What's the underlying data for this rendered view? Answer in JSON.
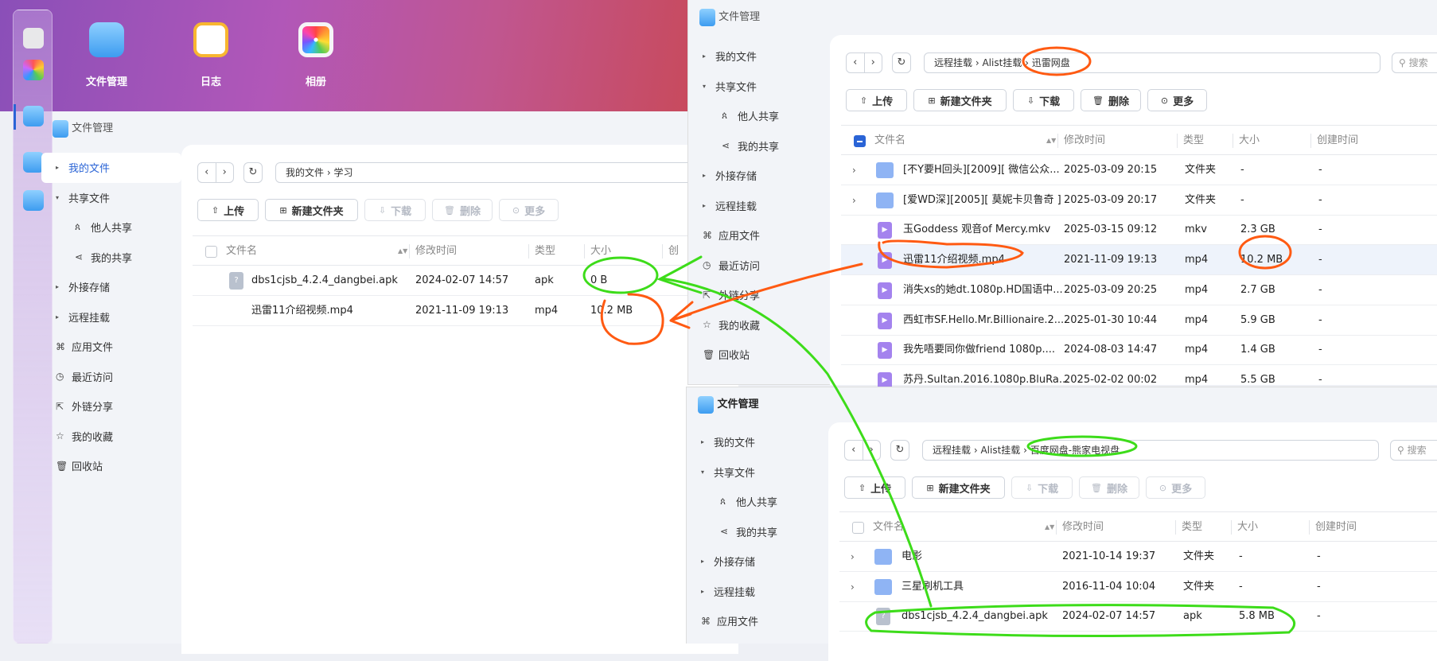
{
  "desktop": {
    "apps": [
      {
        "label": "文件管理",
        "icon": "folder-icon"
      },
      {
        "label": "日志",
        "icon": "notes-icon"
      },
      {
        "label": "相册",
        "icon": "photos-icon"
      }
    ]
  },
  "windows": [
    {
      "title": "文件管理",
      "sidebar": [
        "我的文件",
        "共享文件",
        "他人共享",
        "我的共享",
        "外接存储",
        "远程挂载",
        "应用文件",
        "最近访问",
        "外链分享",
        "我的收藏",
        "回收站"
      ],
      "path": [
        "我的文件",
        "学习"
      ],
      "toolbar": [
        "上传",
        "新建文件夹",
        "下载",
        "删除",
        "更多"
      ],
      "columns": [
        "文件名",
        "修改时间",
        "类型",
        "大小",
        "创"
      ],
      "rows": [
        {
          "name": "dbs1cjsb_4.2.4_dangbei.apk",
          "modified": "2024-02-07 14:57",
          "type": "apk",
          "size": "0 B"
        },
        {
          "name": "迅雷11介绍视频.mp4",
          "modified": "2021-11-09 19:13",
          "type": "mp4",
          "size": "10.2 MB"
        }
      ]
    },
    {
      "title": "文件管理",
      "path": [
        "远程挂载",
        "Alist挂载",
        "迅雷网盘"
      ],
      "search": "搜索",
      "columns": [
        "文件名",
        "修改时间",
        "类型",
        "大小",
        "创建时间"
      ],
      "rows": [
        {
          "name": "[不Y要H回头][2009][ 微信公众...",
          "modified": "2025-03-09 20:15",
          "type": "文件夹",
          "size": "-",
          "created": "-"
        },
        {
          "name": "[爱WD深][2005][ 莫妮卡贝鲁奇 ]",
          "modified": "2025-03-09 20:17",
          "type": "文件夹",
          "size": "-",
          "created": "-"
        },
        {
          "name": "玉Goddess 观音of Mercy.mkv",
          "modified": "2025-03-15 09:12",
          "type": "mkv",
          "size": "2.3 GB",
          "created": "-"
        },
        {
          "name": "迅雷11介绍视频.mp4",
          "modified": "2021-11-09 19:13",
          "type": "mp4",
          "size": "10.2 MB",
          "created": "-"
        },
        {
          "name": "消失xs的她dt.1080p.HD国语中...",
          "modified": "2025-03-09 20:25",
          "type": "mp4",
          "size": "2.7 GB",
          "created": "-"
        },
        {
          "name": "西虹市SF.Hello.Mr.Billionaire.2...",
          "modified": "2025-01-30 10:44",
          "type": "mp4",
          "size": "5.9 GB",
          "created": "-"
        },
        {
          "name": "我先唔要同你做friend 1080p....",
          "modified": "2024-08-03 14:47",
          "type": "mp4",
          "size": "1.4 GB",
          "created": "-"
        },
        {
          "name": "苏丹.Sultan.2016.1080p.BluRa...",
          "modified": "2025-02-02 00:02",
          "type": "mp4",
          "size": "5.5 GB",
          "created": "-"
        }
      ]
    },
    {
      "title": "文件管理",
      "path": [
        "远程挂载",
        "Alist挂载",
        "百度网盘-熊家电视盘"
      ],
      "search": "搜索",
      "columns": [
        "文件名",
        "修改时间",
        "类型",
        "大小",
        "创建时间"
      ],
      "rows": [
        {
          "name": "电影",
          "modified": "2021-10-14 19:37",
          "type": "文件夹",
          "size": "-",
          "created": "-"
        },
        {
          "name": "三星刷机工具",
          "modified": "2016-11-04 10:04",
          "type": "文件夹",
          "size": "-",
          "created": "-"
        },
        {
          "name": "dbs1cjsb_4.2.4_dangbei.apk",
          "modified": "2024-02-07 14:57",
          "type": "apk",
          "size": "5.8 MB",
          "created": "-"
        }
      ]
    }
  ],
  "colors": {
    "accent": "#2a64d6",
    "annotation_green": "#3ddc1a",
    "annotation_orange": "#ff5a12"
  }
}
